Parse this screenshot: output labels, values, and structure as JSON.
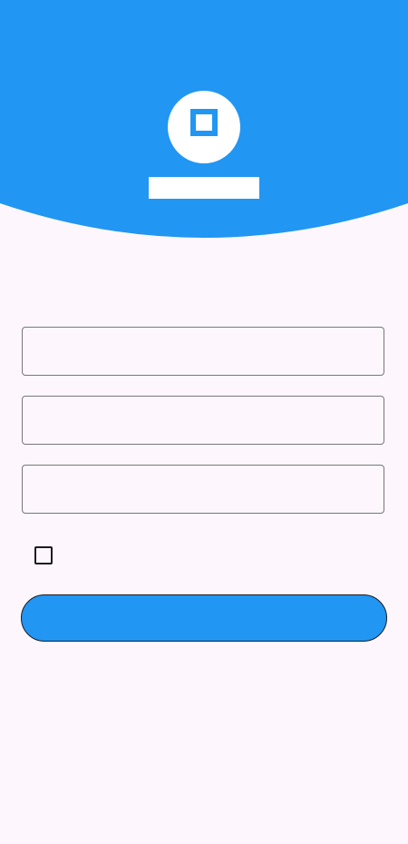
{
  "theme": {
    "primary": "#2196f3",
    "background": "#fdf7fd",
    "outline": "#79747e"
  },
  "header": {
    "logo_icon": "square-logo-icon",
    "app_title": ""
  },
  "form": {
    "name_placeholder": "",
    "phone_placeholder": "",
    "password_placeholder": "",
    "agree_text": "",
    "agree_checked": false
  },
  "actions": {
    "primary_label": "",
    "secondary_label": ""
  }
}
